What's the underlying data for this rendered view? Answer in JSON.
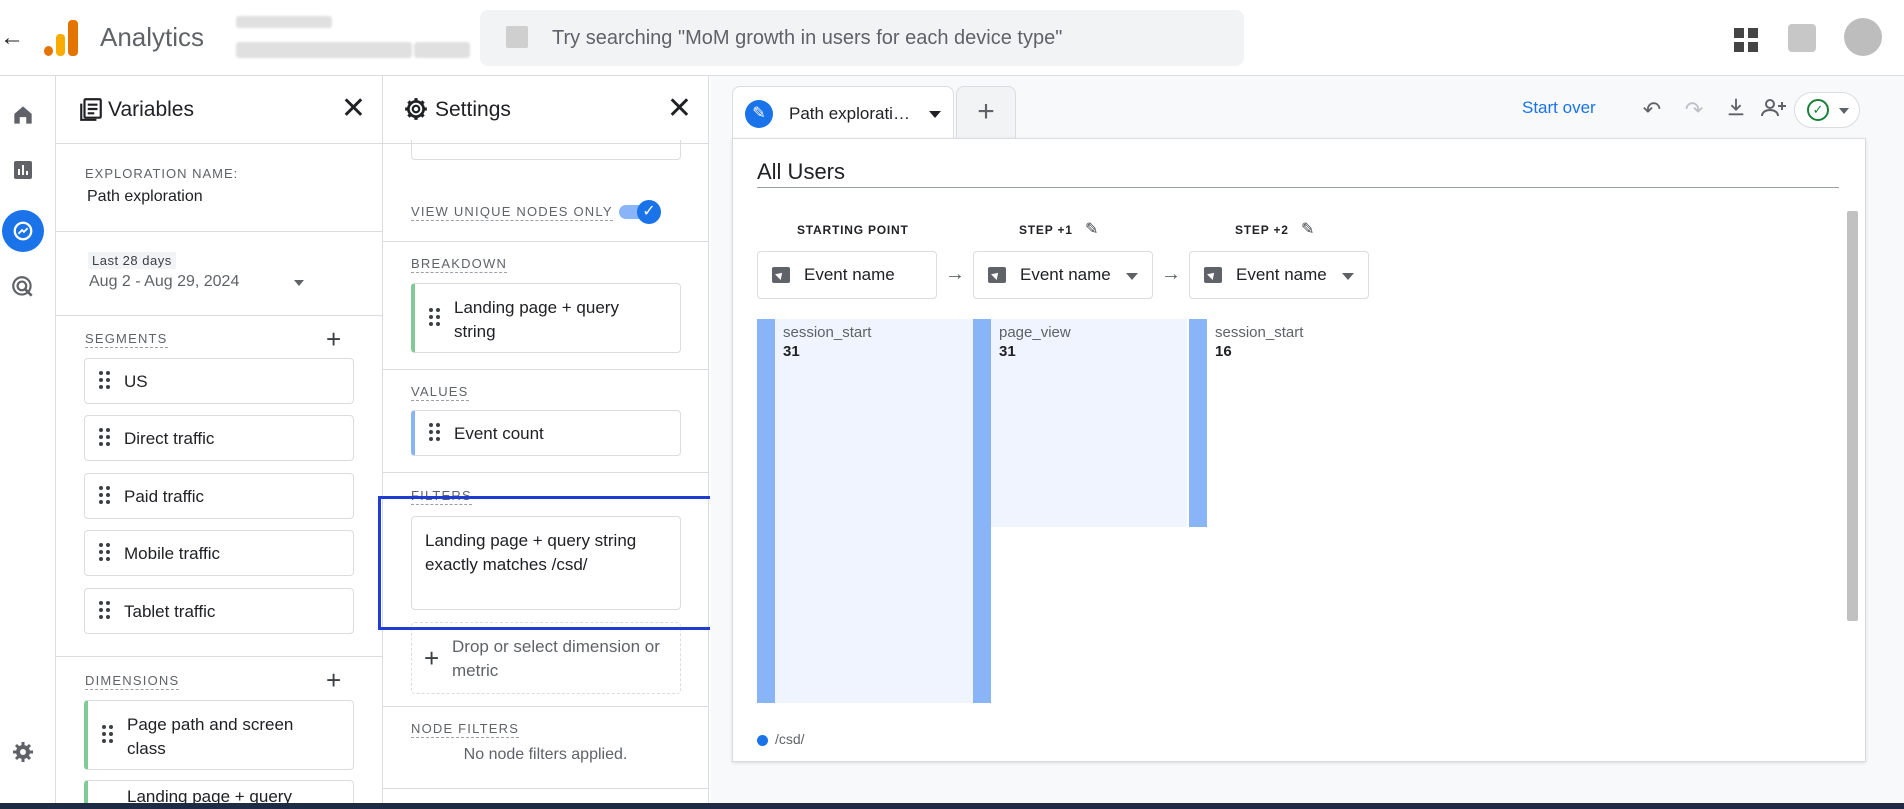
{
  "app": {
    "title": "Analytics",
    "back_icon": "arrow-left-icon"
  },
  "search": {
    "placeholder": "Try searching \"MoM growth in users for each device type\""
  },
  "variables_panel": {
    "title": "Variables",
    "exploration_label": "EXPLORATION NAME:",
    "exploration_name": "Path exploration",
    "date_label": "Last 28 days",
    "date_range": "Aug 2 - Aug 29, 2024",
    "segments_label": "SEGMENTS",
    "segments": [
      "US",
      "Direct traffic",
      "Paid traffic",
      "Mobile traffic",
      "Tablet traffic"
    ],
    "dimensions_label": "DIMENSIONS",
    "dimensions": [
      "Page path and screen class",
      "Landing page + query"
    ]
  },
  "settings_panel": {
    "title": "Settings",
    "view_unique_label": "VIEW UNIQUE NODES ONLY",
    "view_unique_on": true,
    "breakdown_label": "BREAKDOWN",
    "breakdown_value": "Landing page + query string",
    "values_label": "VALUES",
    "values_value": "Event count",
    "filters_label": "FILTERS",
    "filter_text": "Landing page + query string exactly matches /csd/",
    "drop_zone": "Drop or select dimension or metric",
    "node_filters_label": "NODE FILTERS",
    "node_filters_text": "No node filters applied."
  },
  "main": {
    "tab_label": "Path explorati…",
    "start_over": "Start over",
    "segment_title": "All Users",
    "steps": [
      {
        "header": "STARTING POINT",
        "selector": "Event name",
        "node": "session_start",
        "value": "31"
      },
      {
        "header": "STEP +1",
        "selector": "Event name",
        "node": "page_view",
        "value": "31"
      },
      {
        "header": "STEP +2",
        "selector": "Event name",
        "node": "session_start",
        "value": "16"
      }
    ],
    "legend": "/csd/"
  },
  "colors": {
    "accent": "#1a73e8",
    "bar": "#8ab4f8",
    "highlight": "#1f3ed1"
  }
}
